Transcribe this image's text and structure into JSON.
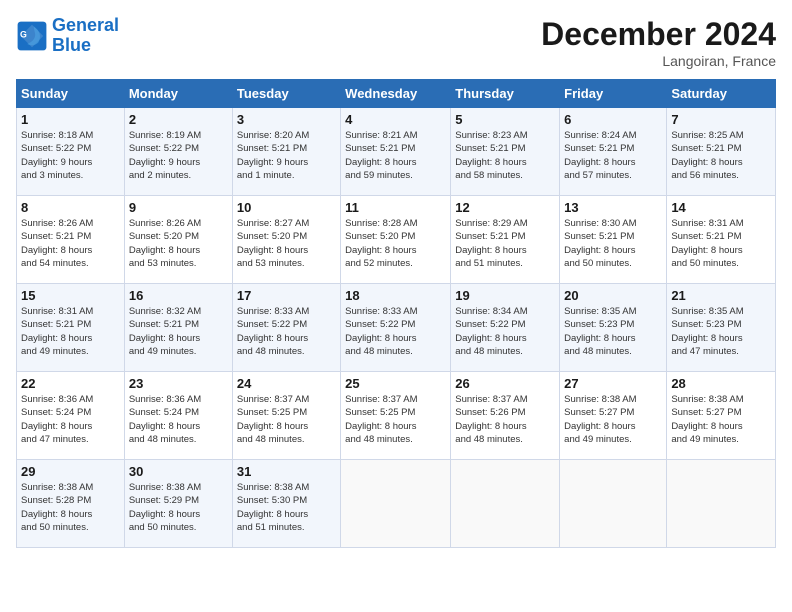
{
  "header": {
    "logo_line1": "General",
    "logo_line2": "Blue",
    "month": "December 2024",
    "location": "Langoiran, France"
  },
  "weekdays": [
    "Sunday",
    "Monday",
    "Tuesday",
    "Wednesday",
    "Thursday",
    "Friday",
    "Saturday"
  ],
  "weeks": [
    [
      {
        "day": "1",
        "info": "Sunrise: 8:18 AM\nSunset: 5:22 PM\nDaylight: 9 hours\nand 3 minutes."
      },
      {
        "day": "2",
        "info": "Sunrise: 8:19 AM\nSunset: 5:22 PM\nDaylight: 9 hours\nand 2 minutes."
      },
      {
        "day": "3",
        "info": "Sunrise: 8:20 AM\nSunset: 5:21 PM\nDaylight: 9 hours\nand 1 minute."
      },
      {
        "day": "4",
        "info": "Sunrise: 8:21 AM\nSunset: 5:21 PM\nDaylight: 8 hours\nand 59 minutes."
      },
      {
        "day": "5",
        "info": "Sunrise: 8:23 AM\nSunset: 5:21 PM\nDaylight: 8 hours\nand 58 minutes."
      },
      {
        "day": "6",
        "info": "Sunrise: 8:24 AM\nSunset: 5:21 PM\nDaylight: 8 hours\nand 57 minutes."
      },
      {
        "day": "7",
        "info": "Sunrise: 8:25 AM\nSunset: 5:21 PM\nDaylight: 8 hours\nand 56 minutes."
      }
    ],
    [
      {
        "day": "8",
        "info": "Sunrise: 8:26 AM\nSunset: 5:21 PM\nDaylight: 8 hours\nand 54 minutes."
      },
      {
        "day": "9",
        "info": "Sunrise: 8:26 AM\nSunset: 5:20 PM\nDaylight: 8 hours\nand 53 minutes."
      },
      {
        "day": "10",
        "info": "Sunrise: 8:27 AM\nSunset: 5:20 PM\nDaylight: 8 hours\nand 53 minutes."
      },
      {
        "day": "11",
        "info": "Sunrise: 8:28 AM\nSunset: 5:20 PM\nDaylight: 8 hours\nand 52 minutes."
      },
      {
        "day": "12",
        "info": "Sunrise: 8:29 AM\nSunset: 5:21 PM\nDaylight: 8 hours\nand 51 minutes."
      },
      {
        "day": "13",
        "info": "Sunrise: 8:30 AM\nSunset: 5:21 PM\nDaylight: 8 hours\nand 50 minutes."
      },
      {
        "day": "14",
        "info": "Sunrise: 8:31 AM\nSunset: 5:21 PM\nDaylight: 8 hours\nand 50 minutes."
      }
    ],
    [
      {
        "day": "15",
        "info": "Sunrise: 8:31 AM\nSunset: 5:21 PM\nDaylight: 8 hours\nand 49 minutes."
      },
      {
        "day": "16",
        "info": "Sunrise: 8:32 AM\nSunset: 5:21 PM\nDaylight: 8 hours\nand 49 minutes."
      },
      {
        "day": "17",
        "info": "Sunrise: 8:33 AM\nSunset: 5:22 PM\nDaylight: 8 hours\nand 48 minutes."
      },
      {
        "day": "18",
        "info": "Sunrise: 8:33 AM\nSunset: 5:22 PM\nDaylight: 8 hours\nand 48 minutes."
      },
      {
        "day": "19",
        "info": "Sunrise: 8:34 AM\nSunset: 5:22 PM\nDaylight: 8 hours\nand 48 minutes."
      },
      {
        "day": "20",
        "info": "Sunrise: 8:35 AM\nSunset: 5:23 PM\nDaylight: 8 hours\nand 48 minutes."
      },
      {
        "day": "21",
        "info": "Sunrise: 8:35 AM\nSunset: 5:23 PM\nDaylight: 8 hours\nand 47 minutes."
      }
    ],
    [
      {
        "day": "22",
        "info": "Sunrise: 8:36 AM\nSunset: 5:24 PM\nDaylight: 8 hours\nand 47 minutes."
      },
      {
        "day": "23",
        "info": "Sunrise: 8:36 AM\nSunset: 5:24 PM\nDaylight: 8 hours\nand 48 minutes."
      },
      {
        "day": "24",
        "info": "Sunrise: 8:37 AM\nSunset: 5:25 PM\nDaylight: 8 hours\nand 48 minutes."
      },
      {
        "day": "25",
        "info": "Sunrise: 8:37 AM\nSunset: 5:25 PM\nDaylight: 8 hours\nand 48 minutes."
      },
      {
        "day": "26",
        "info": "Sunrise: 8:37 AM\nSunset: 5:26 PM\nDaylight: 8 hours\nand 48 minutes."
      },
      {
        "day": "27",
        "info": "Sunrise: 8:38 AM\nSunset: 5:27 PM\nDaylight: 8 hours\nand 49 minutes."
      },
      {
        "day": "28",
        "info": "Sunrise: 8:38 AM\nSunset: 5:27 PM\nDaylight: 8 hours\nand 49 minutes."
      }
    ],
    [
      {
        "day": "29",
        "info": "Sunrise: 8:38 AM\nSunset: 5:28 PM\nDaylight: 8 hours\nand 50 minutes."
      },
      {
        "day": "30",
        "info": "Sunrise: 8:38 AM\nSunset: 5:29 PM\nDaylight: 8 hours\nand 50 minutes."
      },
      {
        "day": "31",
        "info": "Sunrise: 8:38 AM\nSunset: 5:30 PM\nDaylight: 8 hours\nand 51 minutes."
      },
      null,
      null,
      null,
      null
    ]
  ]
}
